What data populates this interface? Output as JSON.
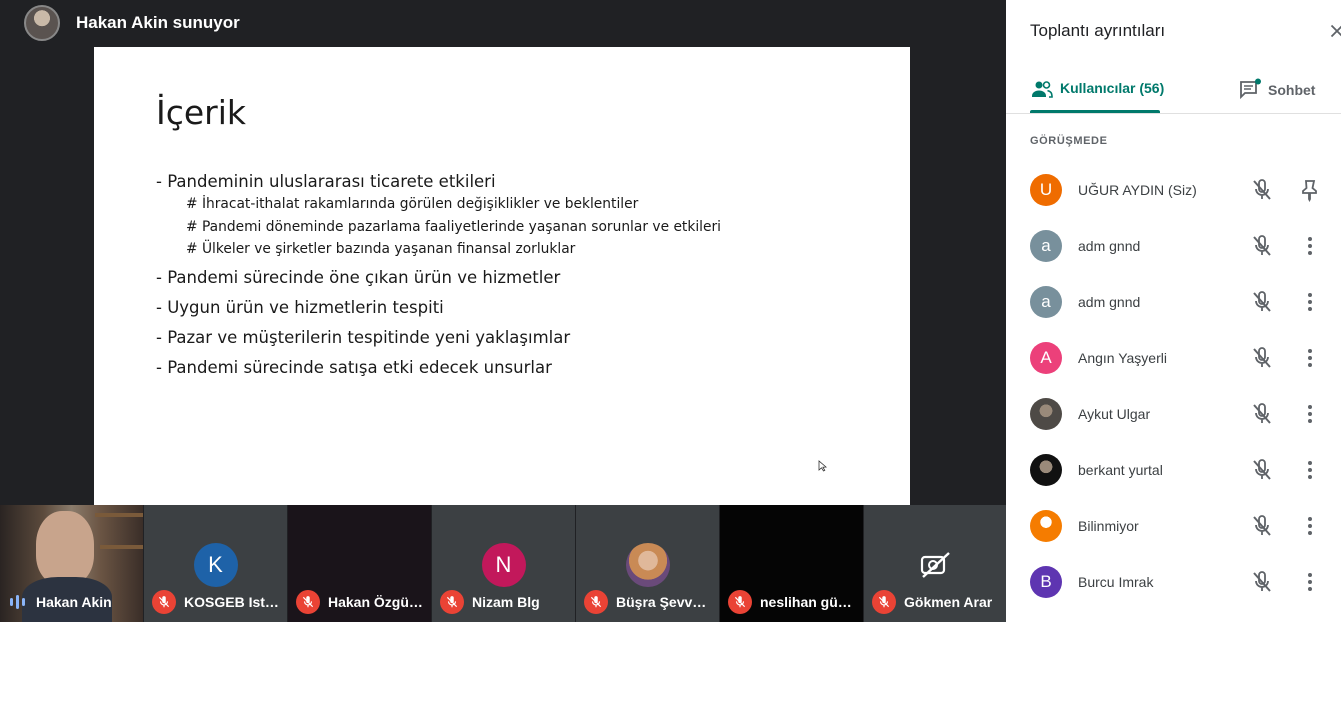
{
  "presenter": {
    "name": "Hakan Akin sunuyor"
  },
  "slide": {
    "title": "İçerik",
    "bullets": [
      {
        "text": "- Pandeminin uluslararası ticarete etkileri",
        "subs": [
          "# İhracat-ithalat rakamlarında görülen değişiklikler ve beklentiler",
          "# Pandemi döneminde pazarlama faaliyetlerinde yaşanan sorunlar ve etkileri",
          "# Ülkeler ve şirketler bazında yaşanan finansal zorluklar"
        ]
      },
      {
        "text": "- Pandemi sürecinde öne çıkan ürün ve hizmetler",
        "subs": []
      },
      {
        "text": "- Uygun ürün ve hizmetlerin tespiti",
        "subs": []
      },
      {
        "text": "- Pazar ve müşterilerin tespitinde yeni yaklaşımlar",
        "subs": []
      },
      {
        "text": "- Pandemi sürecinde satışa etki edecek unsurlar",
        "subs": []
      }
    ]
  },
  "tiles": [
    {
      "name": "Hakan Akin",
      "kind": "video",
      "speaking": true
    },
    {
      "name": "KOSGEB Ista...",
      "kind": "letter",
      "letter": "K",
      "color": "#1e62a8",
      "muted": true
    },
    {
      "name": "Hakan Özgür...",
      "kind": "dark",
      "muted": true
    },
    {
      "name": "Nizam Blg",
      "kind": "letter",
      "letter": "N",
      "color": "#c2185b",
      "muted": true
    },
    {
      "name": "Büşra Şevval ...",
      "kind": "photo",
      "muted": true
    },
    {
      "name": "neslihan gün...",
      "kind": "black",
      "muted": true
    },
    {
      "name": "Gökmen Arar",
      "kind": "camoff",
      "muted": true
    }
  ],
  "panel": {
    "title": "Toplantı ayrıntıları",
    "tab_users": "Kullanıcılar (56)",
    "tab_chat": "Sohbet",
    "section": "GÖRÜŞMEDE",
    "accent": "#00796b",
    "people": [
      {
        "name": "UĞUR AYDIN (Siz)",
        "letter": "U",
        "color": "#ef6c00",
        "action": "pin-icon"
      },
      {
        "name": "adm gnnd",
        "letter": "a",
        "color": "#78909c",
        "action": "more-icon"
      },
      {
        "name": "adm gnnd",
        "letter": "a",
        "color": "#78909c",
        "action": "more-icon"
      },
      {
        "name": "Angın Yaşyerli",
        "letter": "A",
        "color": "#ec407a",
        "action": "more-icon"
      },
      {
        "name": "Aykut Ulgar",
        "letter": "",
        "color": "#4e4a46",
        "action": "more-icon"
      },
      {
        "name": "berkant yurtal",
        "letter": "",
        "color": "#111111",
        "action": "more-icon"
      },
      {
        "name": "Bilinmiyor",
        "letter": "",
        "color": "#f57c00",
        "action": "more-icon"
      },
      {
        "name": "Burcu Imrak",
        "letter": "B",
        "color": "#5e35b1",
        "action": "more-icon"
      }
    ]
  }
}
